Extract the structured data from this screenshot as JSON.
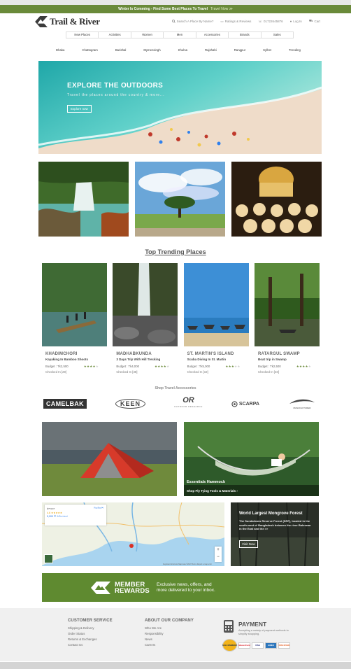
{
  "promo_bar": {
    "text": "Winter Is Comming - Find Some Best Places To Travel",
    "link": "Travel Now  ≫"
  },
  "header": {
    "logo": "Trail & River",
    "search": "Search A Place By Name?",
    "ratings": "Ratings & Reviews",
    "phone": "01722645876",
    "login": "Log In",
    "cart": "Cart"
  },
  "category_nav": [
    "New Places",
    "Activities",
    "Women",
    "Men",
    "Accessories",
    "Brands",
    "Sales"
  ],
  "city_nav": [
    "Dhaka",
    "Chattogram",
    "Barishal",
    "Mymensingh",
    "Khulna",
    "Rajshahi",
    "Rangpur",
    "Sylhet",
    "Trending"
  ],
  "hero": {
    "title": "EXPLORE THE OUTDOORS",
    "subtitle": "Travel the places around the  country & more...",
    "button": "Explore now"
  },
  "trending": {
    "title": "Top Trending Places",
    "cards": [
      {
        "name": "KHADIMCHORI",
        "desc": "Kayaking In Bamboo Shoots",
        "budget": "Budget : Tk2,500",
        "checked": "Checked In [29]",
        "rating": 4
      },
      {
        "name": "MADHABKUNDA",
        "desc": "3 Days Trip With Hill Trecking",
        "budget": "Budget : Tk4,000",
        "checked": "Checked In [38]",
        "rating": 4
      },
      {
        "name": "ST. MARTIN'S ISLAND",
        "desc": "Scuba Diving In St. Martin",
        "budget": "Budget : Tk5,000",
        "checked": "Checked In [19]",
        "rating": 3
      },
      {
        "name": "RATARGUL SWAMP",
        "desc": "Boat trip in Swamp",
        "budget": "Budget : Tk2,500",
        "checked": "Checked In [40]",
        "rating": 4
      }
    ]
  },
  "accessories": {
    "title": "Shop Travel Accessories",
    "brands": {
      "camelbak": "CAMELBAK",
      "keen": "KEEN",
      "or": "OR",
      "or_sub": "OUTDOOR RESEARCH",
      "scarpa": "SCARPA",
      "last": "MANUFACTURED"
    }
  },
  "hammock": {
    "title": "Essentials Hammock",
    "link": "Shop Fly Tying Tools & Materials  ›"
  },
  "map": {
    "place": "সুন্দরবন",
    "rating": "4.6 ★★★★★",
    "reviews": "5,000 টি পর্যালোচনা",
    "directions": "দিকনির্দেশ",
    "footer": "Keyboard shortcuts  Map data ©2023  Terms  Report a map error"
  },
  "forest": {
    "title": "World Largest Mongrove Forest",
    "desc": "The Sundarbans Reserve Forest (SRF), located in the south-west of Bangladesh between the river Baleswar in the East and the >>",
    "button": "Visit Now"
  },
  "rewards": {
    "title1": "MEMBER",
    "title2": "REWARDS",
    "line1": "Exclusive news, offers, and",
    "line2": "more delivered to your inbox."
  },
  "footer": {
    "service": {
      "title": "CUSTOMER SERVICE",
      "links": [
        "Shipping & Delivery",
        "Order Status",
        "Returns & Exchanges",
        "Contact Us"
      ]
    },
    "about": {
      "title": "ABOUT OUR COMPANY",
      "links": [
        "Who We Are",
        "Responsibility",
        "News",
        "Careers"
      ]
    },
    "payment": {
      "title": "PAYMENT",
      "text": "Accepting a variety of payment methods to simplify shopping.",
      "cards": [
        "SSLCOMMERZ",
        "MasterCard",
        "VISA",
        "AMEX",
        "DISCOVER"
      ]
    }
  }
}
